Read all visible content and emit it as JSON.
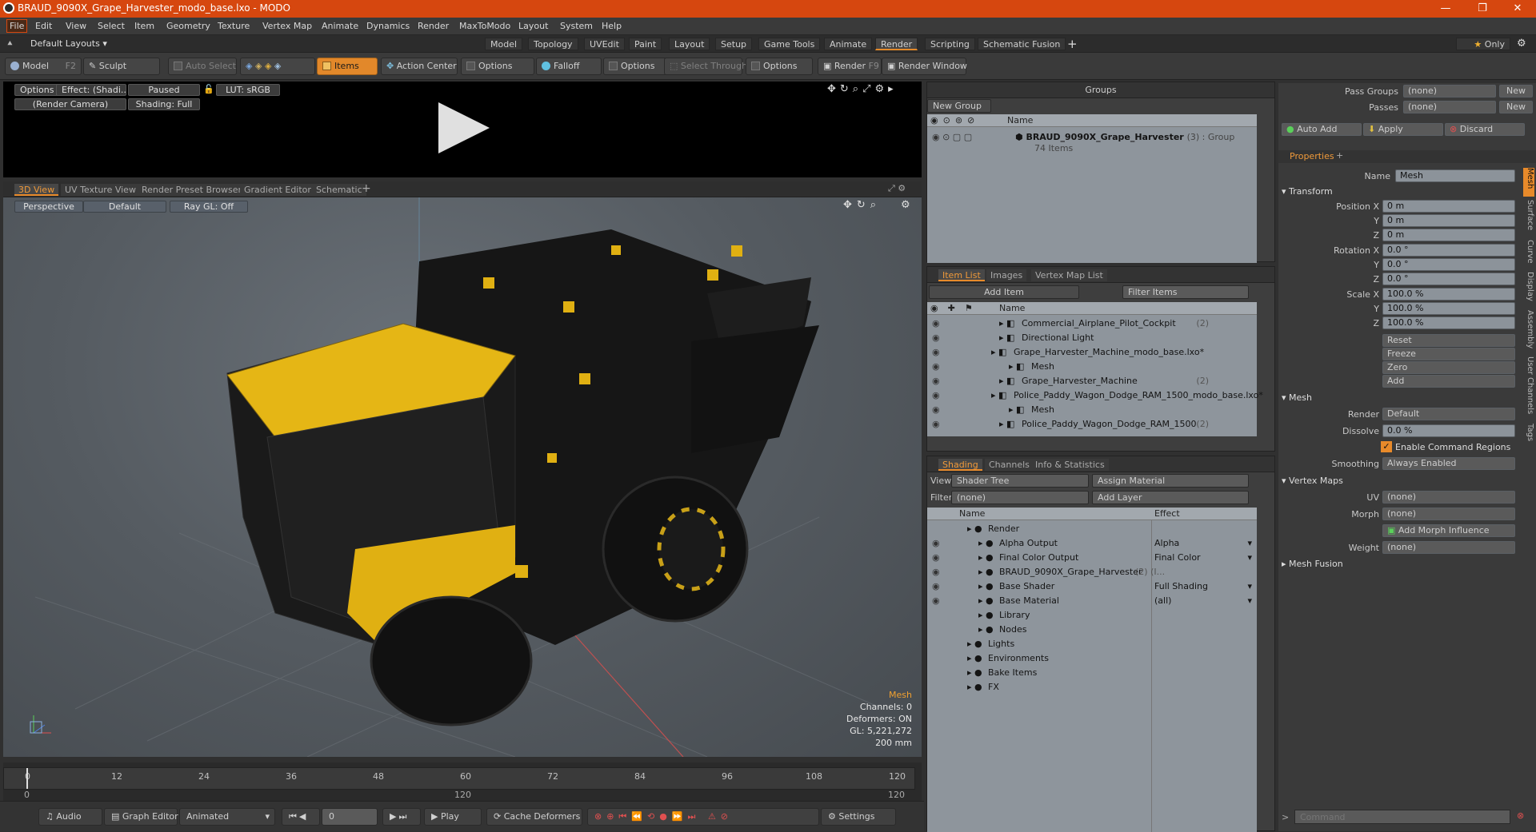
{
  "window": {
    "title": "BRAUD_9090X_Grape_Harvester_modo_base.lxo - MODO"
  },
  "menu": [
    "File",
    "Edit",
    "View",
    "Select",
    "Item",
    "Geometry",
    "Texture",
    "Vertex Map",
    "Animate",
    "Dynamics",
    "Render",
    "MaxToModo",
    "Layout",
    "System",
    "Help"
  ],
  "layouts": {
    "label": "Default Layouts",
    "tabs": [
      "Model",
      "Topology",
      "UVEdit",
      "Paint",
      "Layout",
      "Setup",
      "Game Tools",
      "Animate",
      "Render",
      "Scripting",
      "Schematic Fusion"
    ],
    "active": "Render",
    "only": "Only"
  },
  "toolbar": {
    "model": "Model",
    "model_key": "F2",
    "sculpt": "Sculpt",
    "auto_select": "Auto Select",
    "items": "Items",
    "action_center": "Action Center",
    "options1": "Options",
    "falloff": "Falloff",
    "options2": "Options",
    "select_through": "Select Through",
    "options3": "Options",
    "render": "Render",
    "render_key": "F9",
    "render_window": "Render Window"
  },
  "render_preview": {
    "options": "Options",
    "effect": "Effect: (Shadi...",
    "paused": "Paused",
    "lut": "LUT: sRGB",
    "camera": "(Render Camera)",
    "shading": "Shading: Full"
  },
  "viewport_tabs": [
    "3D View",
    "UV Texture View",
    "Render Preset Browser",
    "Gradient Editor",
    "Schematic"
  ],
  "viewport": {
    "perspective": "Perspective",
    "default": "Default",
    "raygl": "Ray GL: Off"
  },
  "stats": {
    "title": "Mesh",
    "channels": "Channels: 0",
    "deformers": "Deformers: ON",
    "gl": "GL: 5,221,272",
    "scale": "200 mm"
  },
  "timeline": {
    "ticks": [
      "0",
      "12",
      "24",
      "36",
      "48",
      "60",
      "72",
      "84",
      "96",
      "108",
      "120"
    ],
    "sub": [
      "0",
      "120",
      "120"
    ]
  },
  "bottombar": {
    "audio": "Audio",
    "graph_editor": "Graph Editor",
    "animated": "Animated",
    "frame": "0",
    "play": "Play",
    "cache": "Cache Deformers",
    "settings": "Settings"
  },
  "groups": {
    "title": "Groups",
    "new_group": "New Group",
    "col_name": "Name",
    "item_name": "BRAUD_9090X_Grape_Harvester",
    "item_meta": "(3) : Group",
    "item_count": "74 Items"
  },
  "itemlist": {
    "tabs": [
      "Item List",
      "Images",
      "Vertex Map List"
    ],
    "add_item": "Add Item",
    "filter": "Filter Items",
    "col_name": "Name",
    "rows": [
      {
        "label": "Commercial_Airplane_Pilot_Cockpit",
        "meta": "(2)",
        "indent": 90
      },
      {
        "label": "Directional Light",
        "meta": "",
        "indent": 90
      },
      {
        "label": "Grape_Harvester_Machine_modo_base.lxo*",
        "meta": "",
        "indent": 80
      },
      {
        "label": "Mesh",
        "meta": "",
        "indent": 102
      },
      {
        "label": "Grape_Harvester_Machine",
        "meta": "(2)",
        "indent": 90
      },
      {
        "label": "Police_Paddy_Wagon_Dodge_RAM_1500_modo_base.lxo*",
        "meta": "",
        "indent": 80
      },
      {
        "label": "Mesh",
        "meta": "",
        "indent": 102
      },
      {
        "label": "Police_Paddy_Wagon_Dodge_RAM_1500",
        "meta": "(2)",
        "indent": 90
      }
    ]
  },
  "shading": {
    "tabs": [
      "Shading",
      "Channels",
      "Info & Statistics"
    ],
    "view_label": "View",
    "view": "Shader Tree",
    "assign": "Assign Material",
    "filter_label": "Filter",
    "filter": "(none)",
    "add_layer": "Add Layer",
    "col_name": "Name",
    "col_effect": "Effect",
    "rows": [
      {
        "label": "Render",
        "effect": "",
        "indent": 50
      },
      {
        "label": "Alpha Output",
        "effect": "Alpha",
        "indent": 64
      },
      {
        "label": "Final Color Output",
        "effect": "Final Color",
        "indent": 64
      },
      {
        "label": "BRAUD_9090X_Grape_Harvester",
        "effect": "",
        "meta": "(2) (I...",
        "indent": 64
      },
      {
        "label": "Base Shader",
        "effect": "Full Shading",
        "indent": 64
      },
      {
        "label": "Base Material",
        "effect": "(all)",
        "indent": 64
      },
      {
        "label": "Library",
        "effect": "",
        "indent": 64
      },
      {
        "label": "Nodes",
        "effect": "",
        "indent": 64
      },
      {
        "label": "Lights",
        "effect": "",
        "indent": 50
      },
      {
        "label": "Environments",
        "effect": "",
        "indent": 50
      },
      {
        "label": "Bake Items",
        "effect": "",
        "indent": 50
      },
      {
        "label": "FX",
        "effect": "",
        "indent": 50
      }
    ]
  },
  "passes": {
    "pass_groups_label": "Pass Groups",
    "pass_groups": "(none)",
    "passes_label": "Passes",
    "passes": "(none)",
    "new": "New",
    "auto_add": "Auto Add",
    "apply": "Apply",
    "discard": "Discard"
  },
  "properties": {
    "tab": "Properties",
    "name_label": "Name",
    "name": "Mesh",
    "transform": "Transform",
    "position_label": "Position X",
    "pos": [
      "0 m",
      "0 m",
      "0 m"
    ],
    "rotation_label": "Rotation X",
    "rot": [
      "0.0 °",
      "0.0 °",
      "0.0 °"
    ],
    "scale_label": "Scale X",
    "scl": [
      "100.0 %",
      "100.0 %",
      "100.0 %"
    ],
    "y": "Y",
    "z": "Z",
    "reset": "Reset",
    "freeze": "Freeze",
    "zero": "Zero",
    "add": "Add",
    "mesh": "Mesh",
    "render_label": "Render",
    "render": "Default",
    "dissolve_label": "Dissolve",
    "dissolve": "0.0 %",
    "ecr": "Enable Command Regions",
    "smoothing_label": "Smoothing",
    "smoothing": "Always Enabled",
    "vertex_maps": "Vertex Maps",
    "uv_label": "UV",
    "uv": "(none)",
    "morph_label": "Morph",
    "morph": "(none)",
    "add_morph": "Add Morph Influence",
    "weight_label": "Weight",
    "weight": "(none)",
    "mesh_fusion": "Mesh Fusion",
    "side_tabs": [
      "Mesh",
      "Surface",
      "Curve",
      "Display",
      "Assembly",
      "User Channels",
      "Tags"
    ]
  },
  "command": {
    "placeholder": "Command"
  }
}
